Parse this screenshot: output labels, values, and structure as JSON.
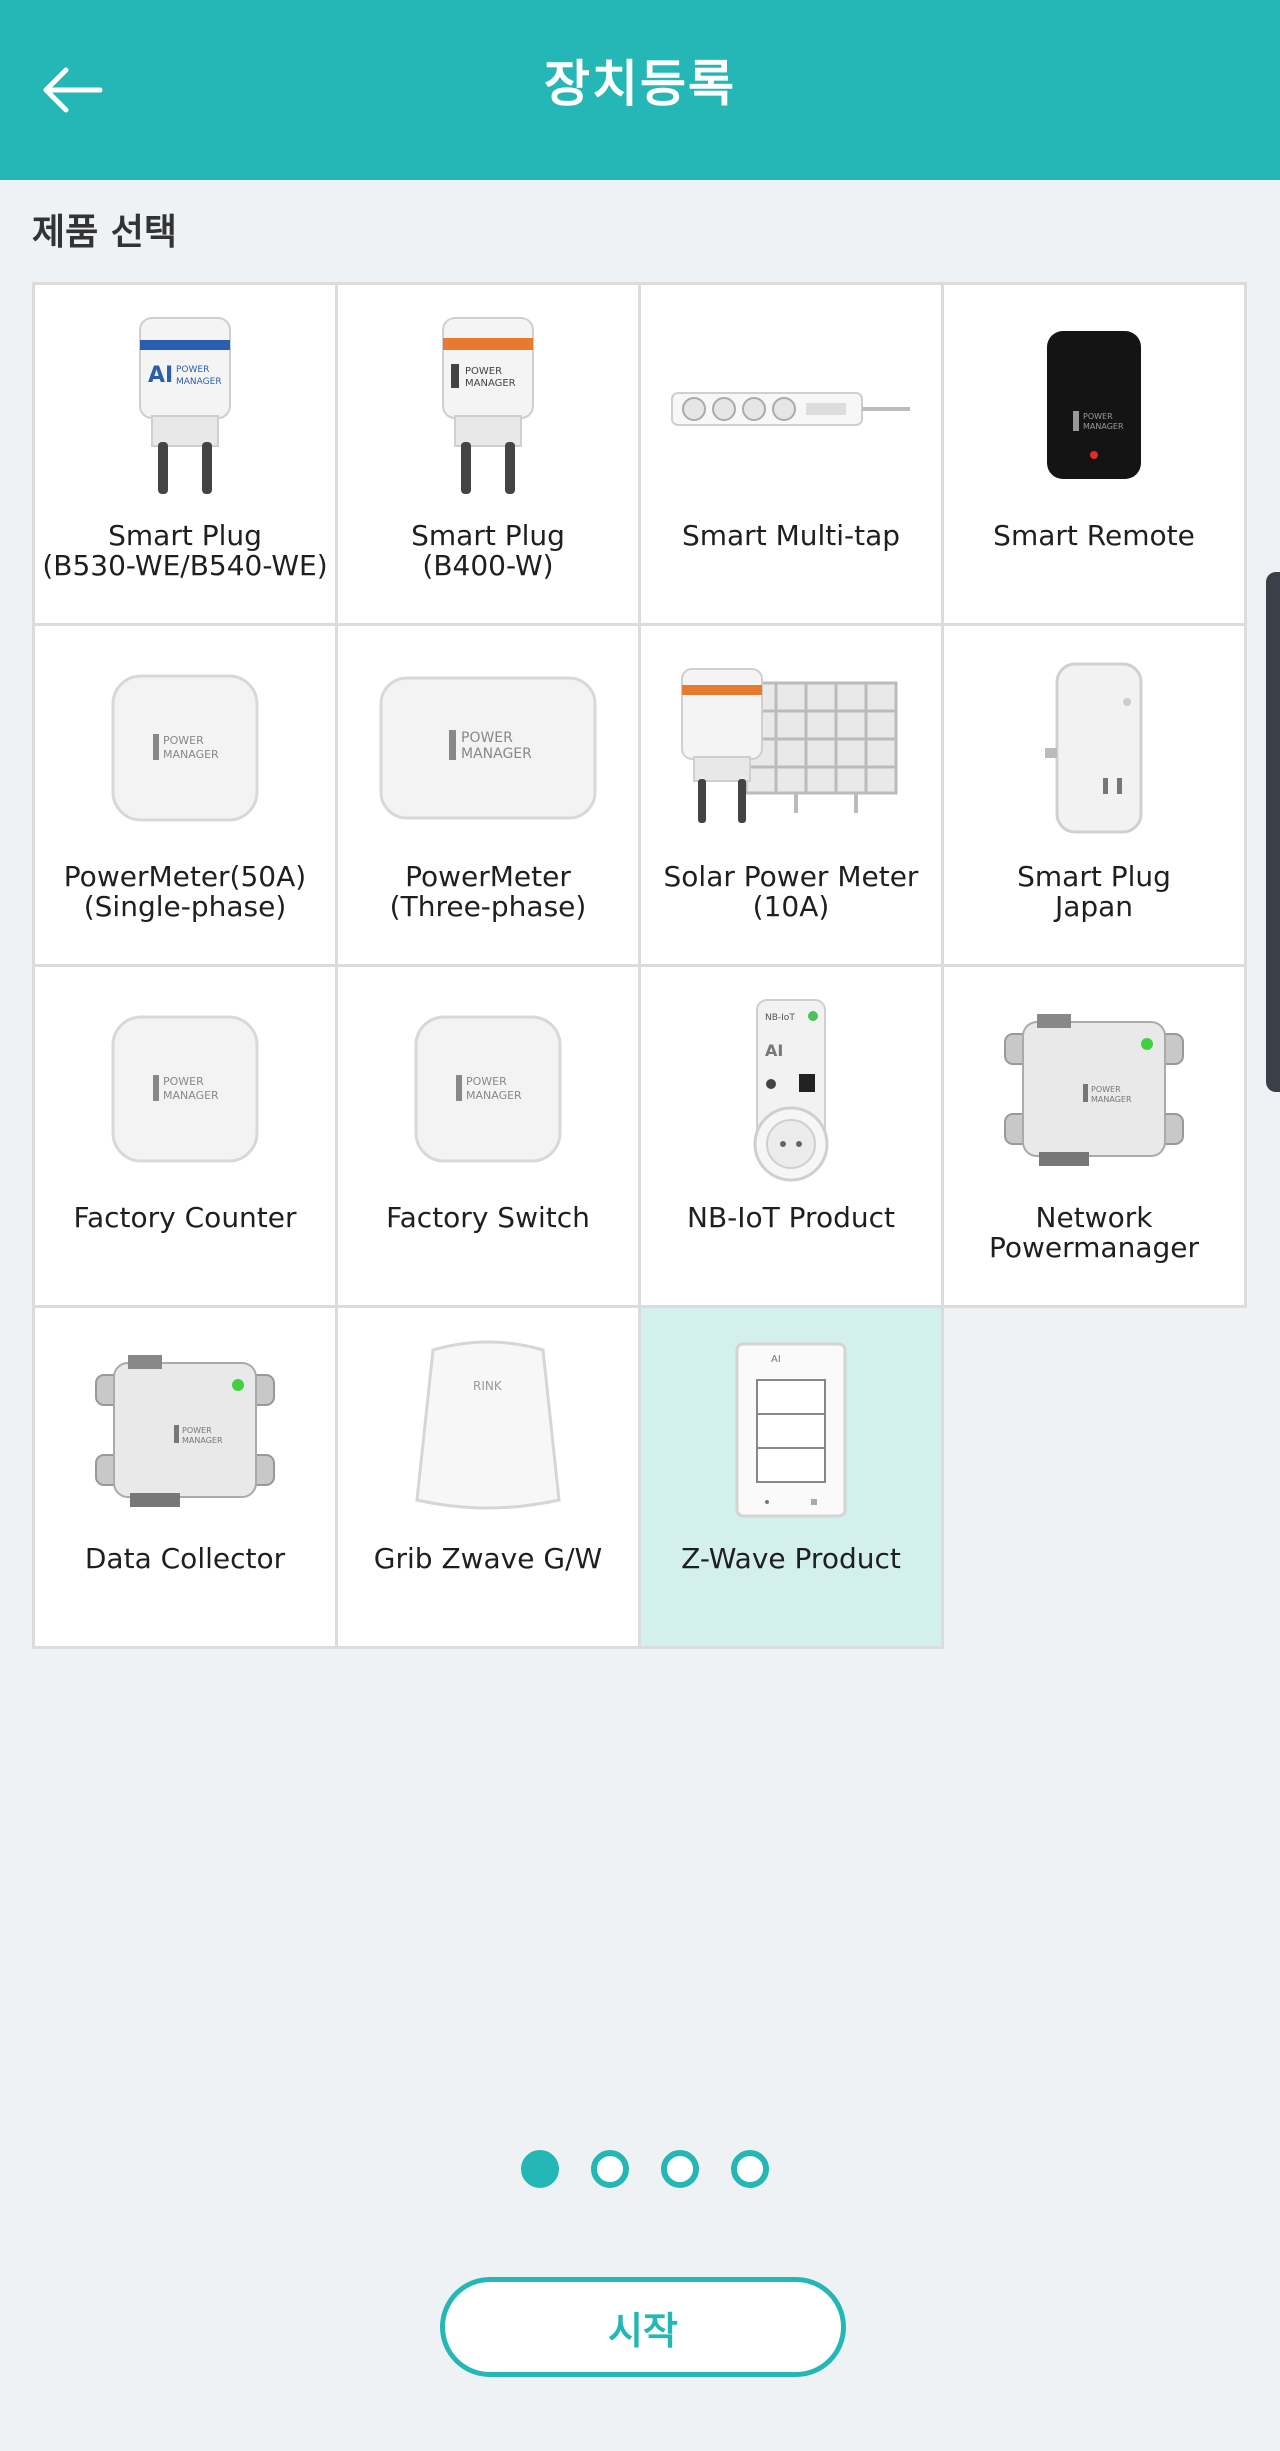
{
  "header": {
    "title": "장치등록",
    "back_icon": "arrow-left-icon"
  },
  "section": {
    "title": "제품 선택"
  },
  "products": [
    {
      "line1": "Smart Plug",
      "line2": "(B530-WE/B540-WE)"
    },
    {
      "line1": "Smart Plug",
      "line2": "(B400-W)"
    },
    {
      "line1": "Smart Multi-tap",
      "line2": ""
    },
    {
      "line1": "Smart Remote",
      "line2": ""
    },
    {
      "line1": "PowerMeter(50A)",
      "line2": "(Single-phase)"
    },
    {
      "line1": "PowerMeter",
      "line2": "(Three-phase)"
    },
    {
      "line1": "Solar Power Meter",
      "line2": "(10A)"
    },
    {
      "line1": "Smart Plug",
      "line2": "Japan"
    },
    {
      "line1": "Factory Counter",
      "line2": ""
    },
    {
      "line1": "Factory Switch",
      "line2": ""
    },
    {
      "line1": "NB-IoT Product",
      "line2": ""
    },
    {
      "line1": "Network",
      "line2": "Powermanager"
    },
    {
      "line1": "Data Collector",
      "line2": ""
    },
    {
      "line1": "Grib Zwave G/W",
      "line2": ""
    },
    {
      "line1": "Z-Wave Product",
      "line2": ""
    }
  ],
  "device_marks": {
    "power_manager": "POWER MANAGER",
    "ai_power_manager": "AI POWER MANAGER",
    "rink": "RINK",
    "nbiot": "NB-IoT"
  },
  "selected_product_index": 14,
  "pagination": {
    "pages": 4,
    "current": 1
  },
  "start_button": {
    "label": "시작"
  },
  "colors": {
    "accent": "#24b7b6",
    "selected_cell": "#d3efee",
    "background": "#eef2f4"
  }
}
